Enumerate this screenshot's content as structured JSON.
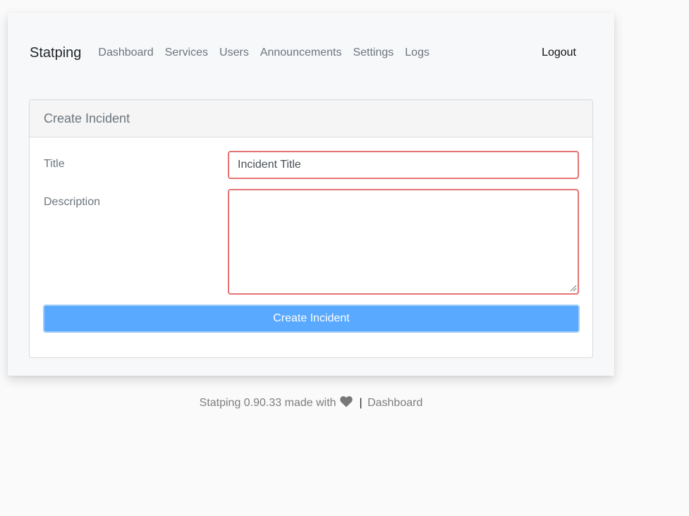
{
  "nav": {
    "brand": "Statping",
    "links": [
      "Dashboard",
      "Services",
      "Users",
      "Announcements",
      "Settings",
      "Logs"
    ],
    "logout": "Logout"
  },
  "form": {
    "header": "Create Incident",
    "title_label": "Title",
    "title_placeholder": "Incident Title",
    "title_value": "",
    "description_label": "Description",
    "description_value": "",
    "submit_label": "Create Incident",
    "error_border_color": "#e57373",
    "button_color": "#58a9ff"
  },
  "footer": {
    "text": "Statping 0.90.33 made with",
    "heart_icon": "heart-icon",
    "separator": "|",
    "link": "Dashboard"
  }
}
